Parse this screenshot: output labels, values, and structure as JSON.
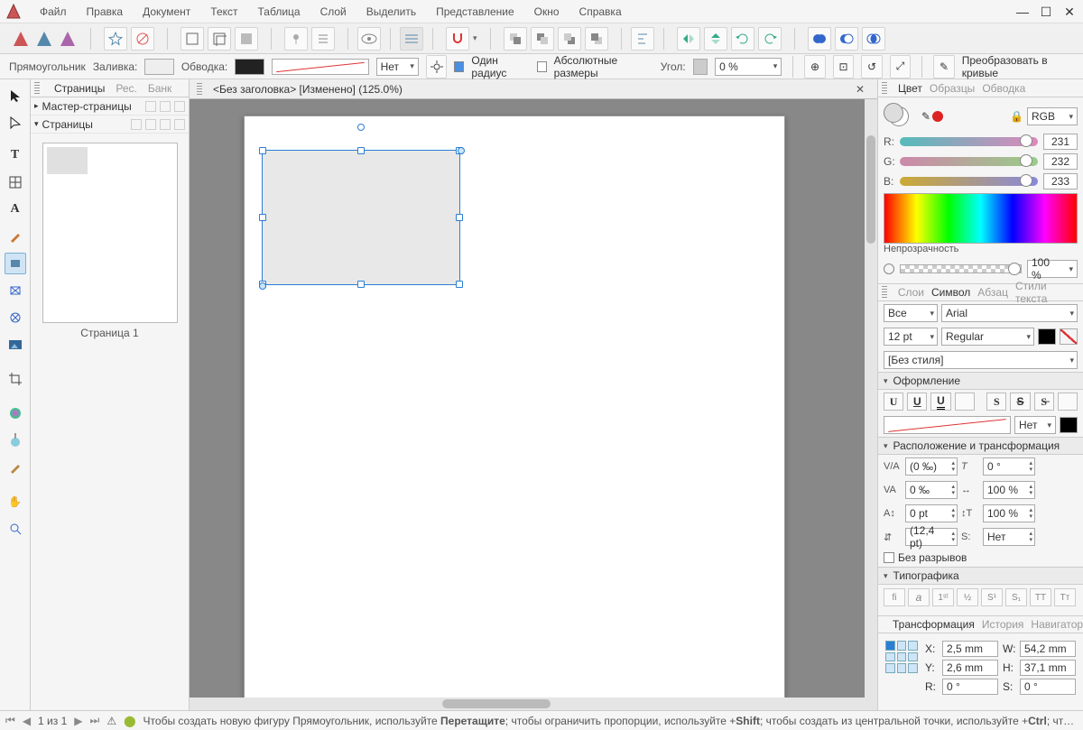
{
  "menu": {
    "file": "Файл",
    "edit": "Правка",
    "document": "Документ",
    "text": "Текст",
    "table": "Таблица",
    "layer": "Слой",
    "select": "Выделить",
    "view": "Представление",
    "window": "Окно",
    "help": "Справка"
  },
  "context": {
    "tool": "Прямоугольник",
    "fill_label": "Заливка:",
    "stroke_label": "Обводка:",
    "stroke_style": "Нет",
    "one_radius": "Один радиус",
    "abs_dims": "Абсолютные размеры",
    "angle_label": "Угол:",
    "angle_value": "0 %",
    "convert": "Преобразовать в кривые"
  },
  "left_tabs": {
    "pages": "Страницы",
    "res": "Рес.",
    "bank": "Банк"
  },
  "tree": {
    "master": "Мастер-страницы",
    "pages": "Страницы",
    "page1_label": "Страница 1"
  },
  "doc_tab": "<Без заголовка> [Изменено] (125.0%)",
  "color_panel": {
    "tabs": {
      "color": "Цвет",
      "samples": "Образцы",
      "stroke": "Обводка"
    },
    "model": "RGB",
    "r": "231",
    "g": "232",
    "b": "233",
    "opacity_label": "Непрозрачность",
    "opacity_value": "100 %"
  },
  "char_panel": {
    "tabs": {
      "layers": "Слои",
      "symbol": "Символ",
      "para": "Абзац",
      "text_styles": "Стили текста"
    },
    "all": "Все",
    "font": "Arial",
    "size": "12 pt",
    "weight": "Regular",
    "no_style": "[Без стиля]",
    "decoration_header": "Оформление",
    "decoration_none": "Нет",
    "position_header": "Расположение и трансформация",
    "kerning": "(0 ‰)",
    "tracking": "0 ‰",
    "baseline": "0 pt",
    "leading": "(12,4 pt)",
    "slant": "0 °",
    "hscale": "100 %",
    "vscale": "100 %",
    "shear": "Нет",
    "no_breaks": "Без разрывов",
    "typography_header": "Типографика"
  },
  "transform_panel": {
    "tabs": {
      "transform": "Трансформация",
      "history": "История",
      "navigator": "Навигатор"
    },
    "x": "2,5 mm",
    "y": "2,6 mm",
    "w": "54,2 mm",
    "h": "37,1 mm",
    "r": "0 °",
    "s": "0 °"
  },
  "status": {
    "page": "1 из 1",
    "hint_pre": "Чтобы создать новую фигуру Прямоугольник, используйте ",
    "hint_bold1": "Перетащите",
    "hint_mid": "; чтобы ограничить пропорции, используйте +",
    "hint_bold2": "Shift",
    "hint_mid2": "; чтобы создать из центральной точки, используйте +",
    "hint_bold3": "Ctrl",
    "hint_end": "; чтобы создать вдоль"
  }
}
